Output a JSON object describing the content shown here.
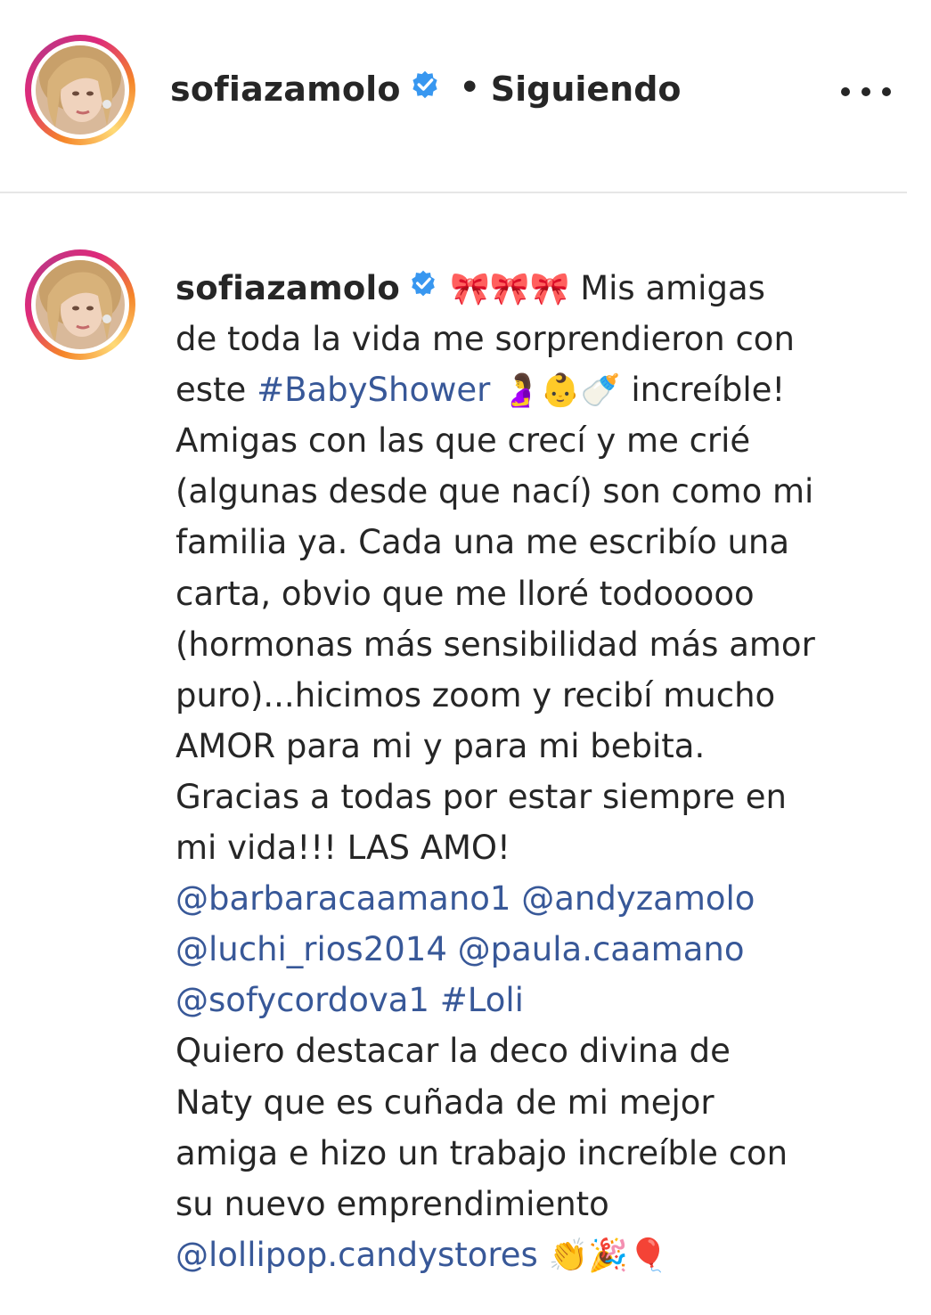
{
  "header": {
    "username": "sofiazamolo",
    "separator": "•",
    "follow_status": "Siguiendo",
    "more_icon": "more-horizontal-icon",
    "verified_icon": "verified-badge-icon"
  },
  "caption": {
    "username": "sofiazamolo",
    "l1_emoji": "🎀🎀🎀",
    "l1_text": "Mis amigas",
    "l2": "de toda la vida me sorprendieron con",
    "l3_pre": "este",
    "l3_tag": "#BabyShower",
    "l3_emoji": "🤰👶🍼",
    "l3_post": "increíble!",
    "l4": "Amigas con las que crecí y me crié",
    "l5": "(algunas desde que nací) son como mi",
    "l6": "familia ya. Cada una me escribío una",
    "l7": "carta, obvio que me lloré todooooo",
    "l8": "(hormonas más sensibilidad más amor",
    "l9": "puro)...hicimos zoom y recibí mucho",
    "l10": "AMOR para mi y para mi bebita.",
    "l11": "Gracias a todas por estar siempre en",
    "l12": "mi vida!!! LAS AMO!",
    "mentions": [
      "@barbaracaamano1",
      "@andyzamolo",
      "@luchi_rios2014",
      "@paula.caamano",
      "@sofycordova1"
    ],
    "hashtag_loli": "#Loli",
    "l16": "Quiero destacar la deco divina de",
    "l17": "Naty que es cuñada de mi mejor",
    "l18": "amiga e hizo un trabajo increíble con",
    "l19": "su nuevo emprendimiento",
    "l20_mention": "@lollipop.candystores",
    "l20_emoji": "👏🎉🎈"
  },
  "colors": {
    "text": "#262626",
    "link": "#385898",
    "verified": "#3897f0",
    "divider": "#e6e6e6"
  }
}
